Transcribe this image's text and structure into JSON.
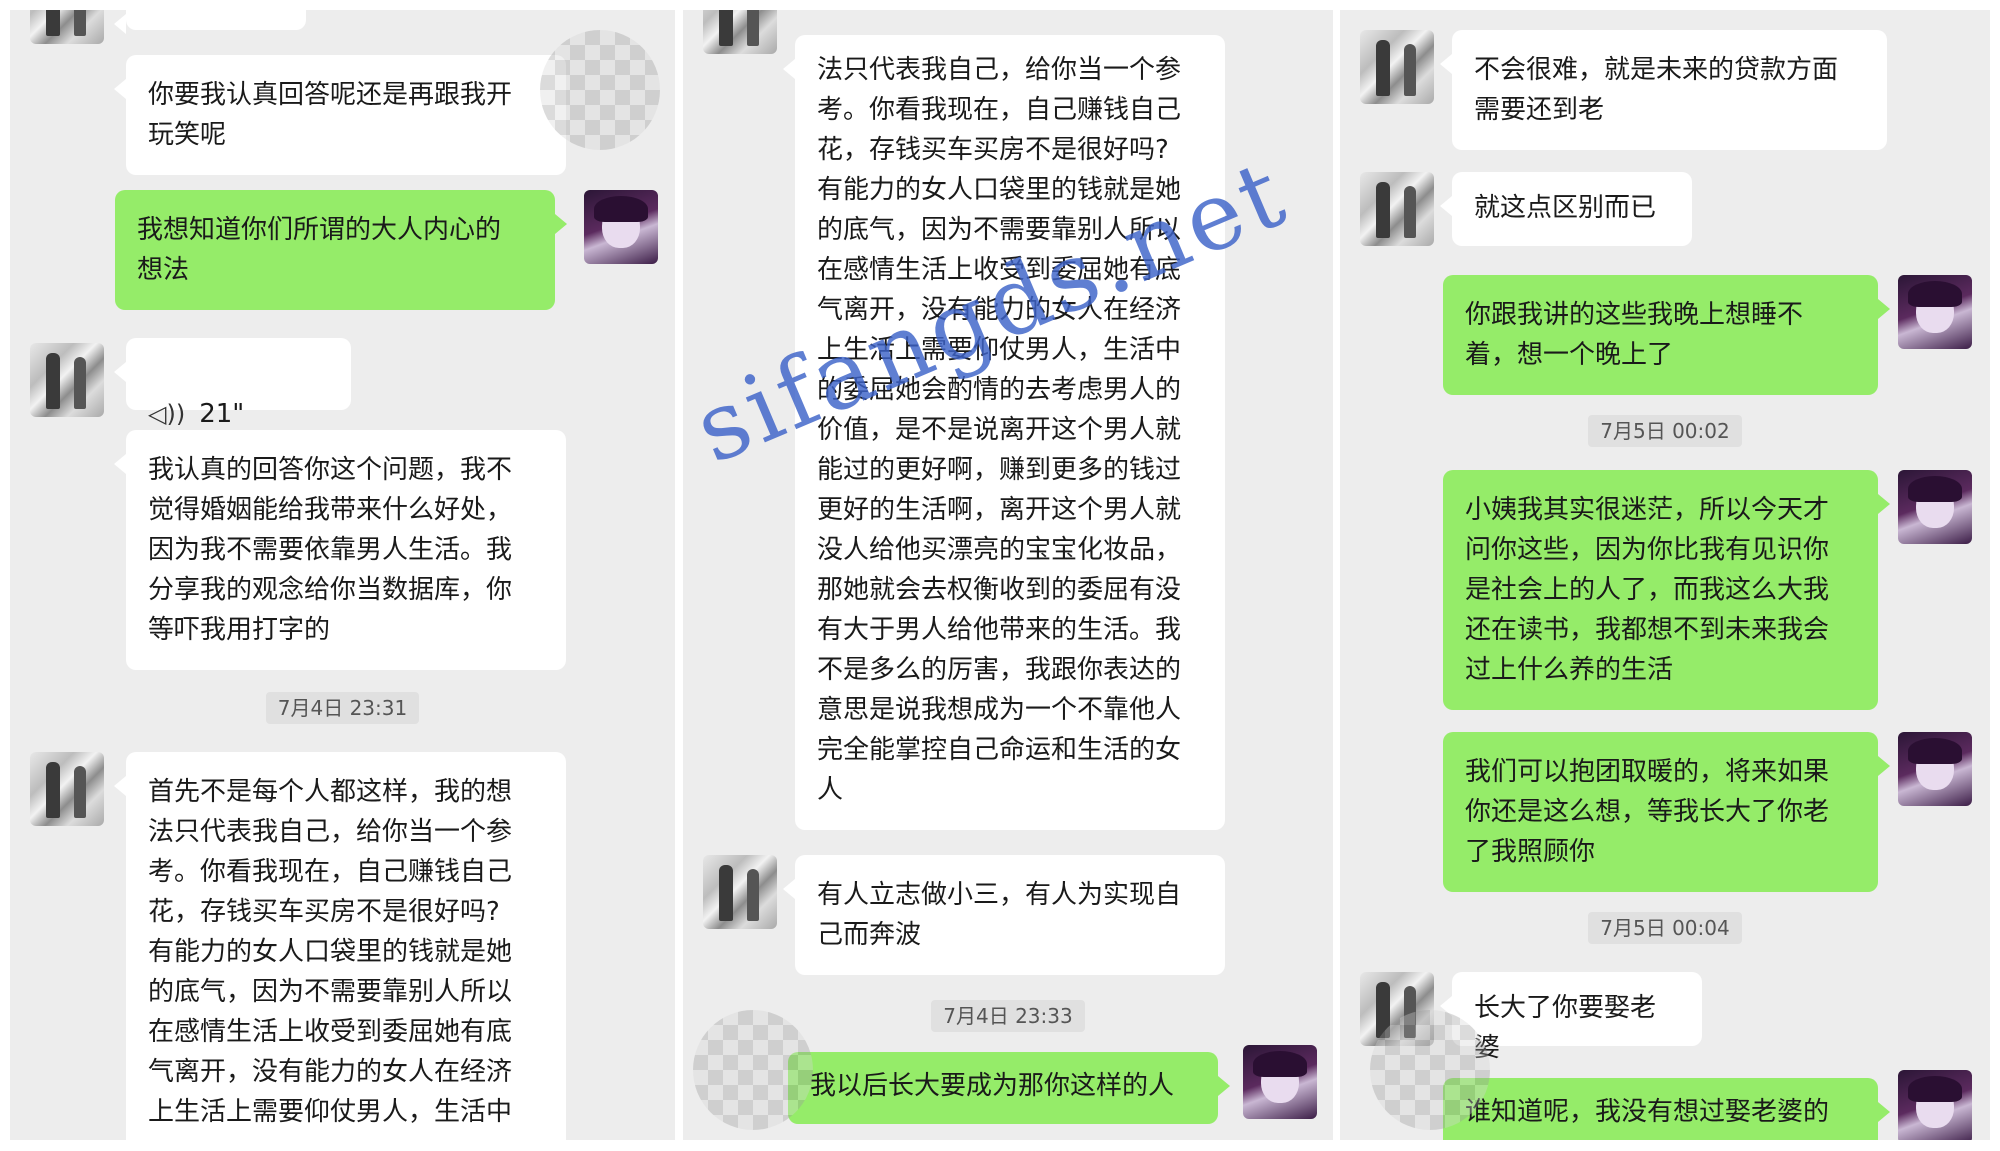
{
  "panel1": {
    "m1": "你要我认真回答呢还是再跟我开\n玩笑呢",
    "m2": "我想知道你们所谓的大人内心的\n想法",
    "voice": "21\"",
    "m3": "我认真的回答你这个问题，我不\n觉得婚姻能给我带来什么好处，\n因为我不需要依靠男人生活。我\n分享我的观念给你当数据库，你\n等吓我用打字的",
    "time1": "7月4日 23:31",
    "m4": "首先不是每个人都这样，我的想\n法只代表我自己，给你当一个参\n考。你看我现在，自己赚钱自己\n花，存钱买车买房不是很好吗?\n有能力的女人口袋里的钱就是她\n的底气，因为不需要靠别人所以\n在感情生活上收受到委屈她有底\n气离开，没有能力的女人在经济\n上生活上需要仰仗男人，生活中"
  },
  "panel2": {
    "m1": "法只代表我自己，给你当一个参\n考。你看我现在，自己赚钱自己\n花，存钱买车买房不是很好吗?\n有能力的女人口袋里的钱就是她\n的底气，因为不需要靠别人所以\n在感情生活上收受到委屈她有底\n气离开，没有能力的女人在经济\n上生活上需要仰仗男人，生活中\n的委屈她会酌情的去考虑男人的\n价值，是不是说离开这个男人就\n能过的更好啊，赚到更多的钱过\n更好的生活啊，离开这个男人就\n没人给他买漂亮的宝宝化妆品，\n那她就会去权衡收到的委屈有没\n有大于男人给他带来的生活。我\n不是多么的厉害，我跟你表达的\n意思是说我想成为一个不靠他人\n完全能掌控自己命运和生活的女\n人",
    "m2": "有人立志做小三，有人为实现自\n己而奔波",
    "time1": "7月4日 23:33",
    "m3": "我以后长大要成为那你这样的人"
  },
  "panel3": {
    "m1": "不会很难，就是未来的贷款方面\n需要还到老",
    "m2": "就这点区别而已",
    "m3": "你跟我讲的这些我晚上想睡不\n着，想一个晚上了",
    "time1": "7月5日 00:02",
    "m4": "小姨我其实很迷茫，所以今天才\n问你这些，因为你比我有见识你\n是社会上的人了，而我这么大我\n还在读书，我都想不到未来我会\n过上什么养的生活",
    "m5": "我们可以抱团取暖的，将来如果\n你还是这么想，等我长大了你老\n了我照顾你",
    "time2": "7月5日 00:04",
    "m6": "长大了你要娶老婆",
    "m7": "谁知道呢，我没有想过娶老婆的"
  },
  "watermark": "sifangds.net",
  "colors": {
    "incoming_bubble": "#ffffff",
    "outgoing_bubble": "#95ec69",
    "chat_background": "#ededed",
    "watermark": "#3d63c9"
  }
}
